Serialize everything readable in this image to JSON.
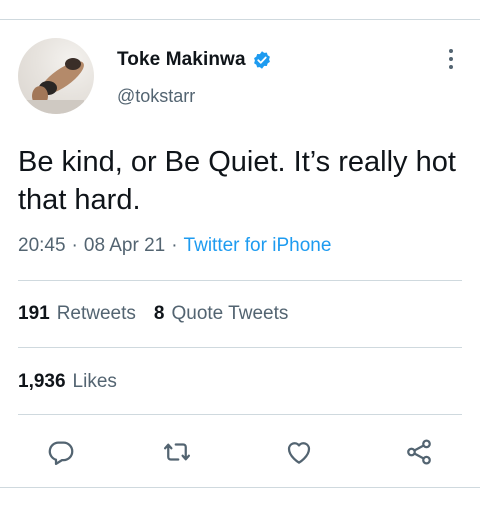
{
  "tweet": {
    "author_name": "Toke Makinwa",
    "handle": "@tokstarr",
    "verified": true,
    "text": "Be kind, or Be Quiet. It’s really hot that hard.",
    "time": "20:45",
    "date": "08 Apr 21",
    "source": "Twitter for iPhone",
    "separator": "·"
  },
  "stats": {
    "retweets_count": "191",
    "retweets_label": "Retweets",
    "quote_count": "8",
    "quote_label": "Quote Tweets",
    "likes_count": "1,936",
    "likes_label": "Likes"
  },
  "icons": {
    "verified": "verified-badge-icon",
    "more": "more-vertical-icon",
    "reply": "reply-icon",
    "retweet": "retweet-icon",
    "like": "heart-icon",
    "share": "share-icon"
  },
  "colors": {
    "accent": "#1d9bf0",
    "text": "#0f1419",
    "secondary": "#536471",
    "divider": "#cfd9de"
  }
}
